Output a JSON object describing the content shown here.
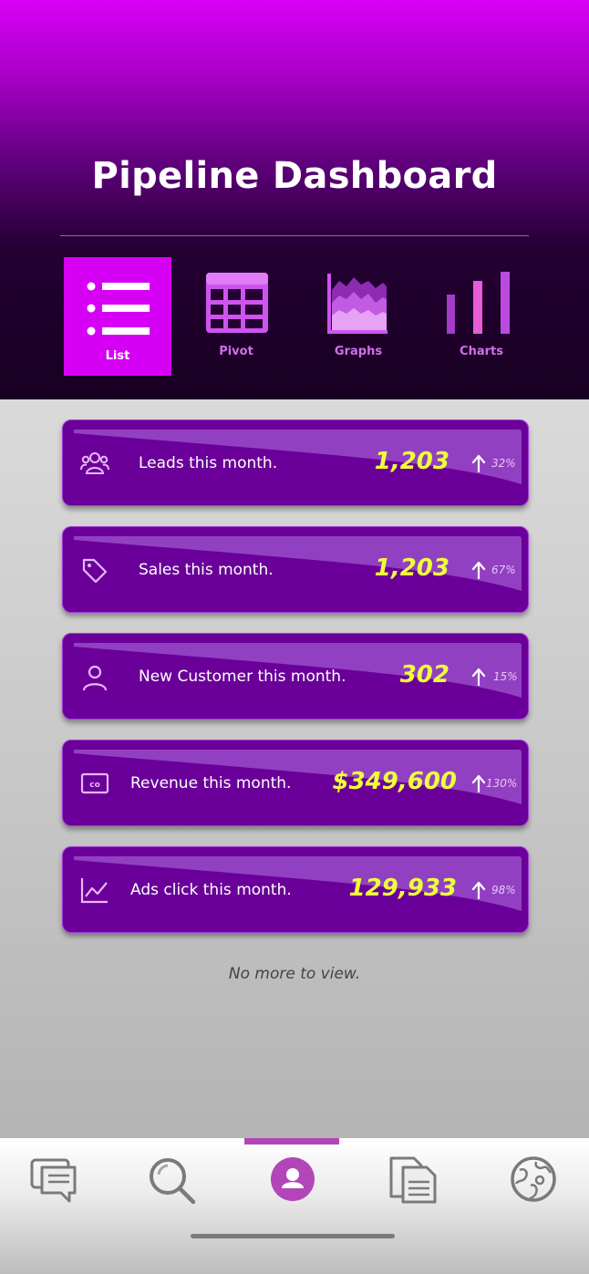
{
  "header": {
    "title": "Pipeline Dashboard",
    "tabs": [
      {
        "label": "List",
        "icon": "list-icon",
        "active": true
      },
      {
        "label": "Pivot",
        "icon": "table-grid-icon",
        "active": false
      },
      {
        "label": "Graphs",
        "icon": "area-graph-icon",
        "active": false
      },
      {
        "label": "Charts",
        "icon": "bar-chart-icon",
        "active": false
      }
    ]
  },
  "cards": [
    {
      "icon": "users-icon",
      "label": "Leads this month.",
      "value": "1,203",
      "change": "32%"
    },
    {
      "icon": "tag-icon",
      "label": "Sales this month.",
      "value": "1,203",
      "change": "67%"
    },
    {
      "icon": "user-icon",
      "label": "New Customer this month.",
      "value": "302",
      "change": "15%"
    },
    {
      "icon": "money-icon",
      "label": "Revenue this month.",
      "value": "$349,600",
      "change": "130%"
    },
    {
      "icon": "line-chart-icon",
      "label": "Ads click this month.",
      "value": "129,933",
      "change": "98%"
    }
  ],
  "footnote": "No more to view.",
  "nav": {
    "items": [
      "chat-icon",
      "search-icon",
      "profile-icon",
      "documents-icon",
      "globe-icon"
    ],
    "active_index": 2
  },
  "colors": {
    "accent": "#d600f5",
    "card_bg": "#6a0099",
    "value_yellow": "#eeff3a",
    "nav_active": "#b246b8"
  }
}
